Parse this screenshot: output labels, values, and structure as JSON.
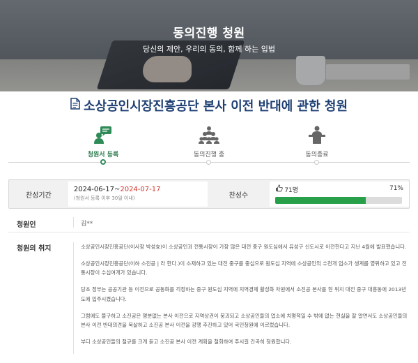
{
  "hero": {
    "title": "동의진행 청원",
    "subtitle": "당신의 제안, 우리의 동의, 함께 하는 입법"
  },
  "petition": {
    "title": "소상공인시장진흥공단 본사 이전 반대에 관한 청원"
  },
  "steps": [
    {
      "label": "청원서 등록",
      "icon": "chat-user-icon",
      "active": true
    },
    {
      "label": "동의진행 중",
      "icon": "group-icon",
      "active": false
    },
    {
      "label": "동의종료",
      "icon": "podium-icon",
      "active": false
    }
  ],
  "period": {
    "label": "찬성기간",
    "start": "2024-06-17~",
    "end": "2024-07-17",
    "note": "(청원서 등록 이후 30일 이내)"
  },
  "support": {
    "label": "찬성수",
    "count": "71명",
    "percent_text": "71%",
    "percent": 71
  },
  "petitioner": {
    "label": "청원인",
    "value": "김**"
  },
  "purpose": {
    "label": "청원의 취지",
    "paragraphs": [
      "소상공인시장진흥공단(이사장 박성효)이 소상공인과 전통시장이 가장 많은 대전 중구 원도심에서 유성구 신도시로 이전한다고 지난 4월에 발표했습니다.",
      "소상공인시장진흥공단(이하 소진공 | 라 한다.)이 소재하고 있는 대전 중구를 중심으로 원도심 지역에 소상공인의 수천개 업소가 생계를 영위하고 있고 전통시장이 수십여개가 있습니다.",
      "당초 정부는 공공기관 등 이전으로 공동화를 걱정하는 중구 원도심 지역에 지역경제 활성화 차원에서 소진공 본사를 현 위치 대전 중구 대흥동에 2013년도에 입주시켰습니다.",
      "그럼에도 불구하고 소진공은 명분없는 본사 이전으로 지역상권이 붕괴되고 소상공인들의 업소에 치명적일 수 밖에 없는 현실을 잘 알면서도 소상공인들의 본사 이전 반대의견을 묵살하고 소진공 본사 이전을 강행 추진하고 있어 국민청원에 이르렀습니다.",
      "부디 소상공인들의 절규를 크게 듣고 소진공 본사 이전 계획을 철회하여 주시길 간곡히 청원합니다."
    ]
  },
  "colors": {
    "title_blue": "#1e3f73",
    "accent_green": "#27a049",
    "end_date_red": "#d0372e"
  }
}
